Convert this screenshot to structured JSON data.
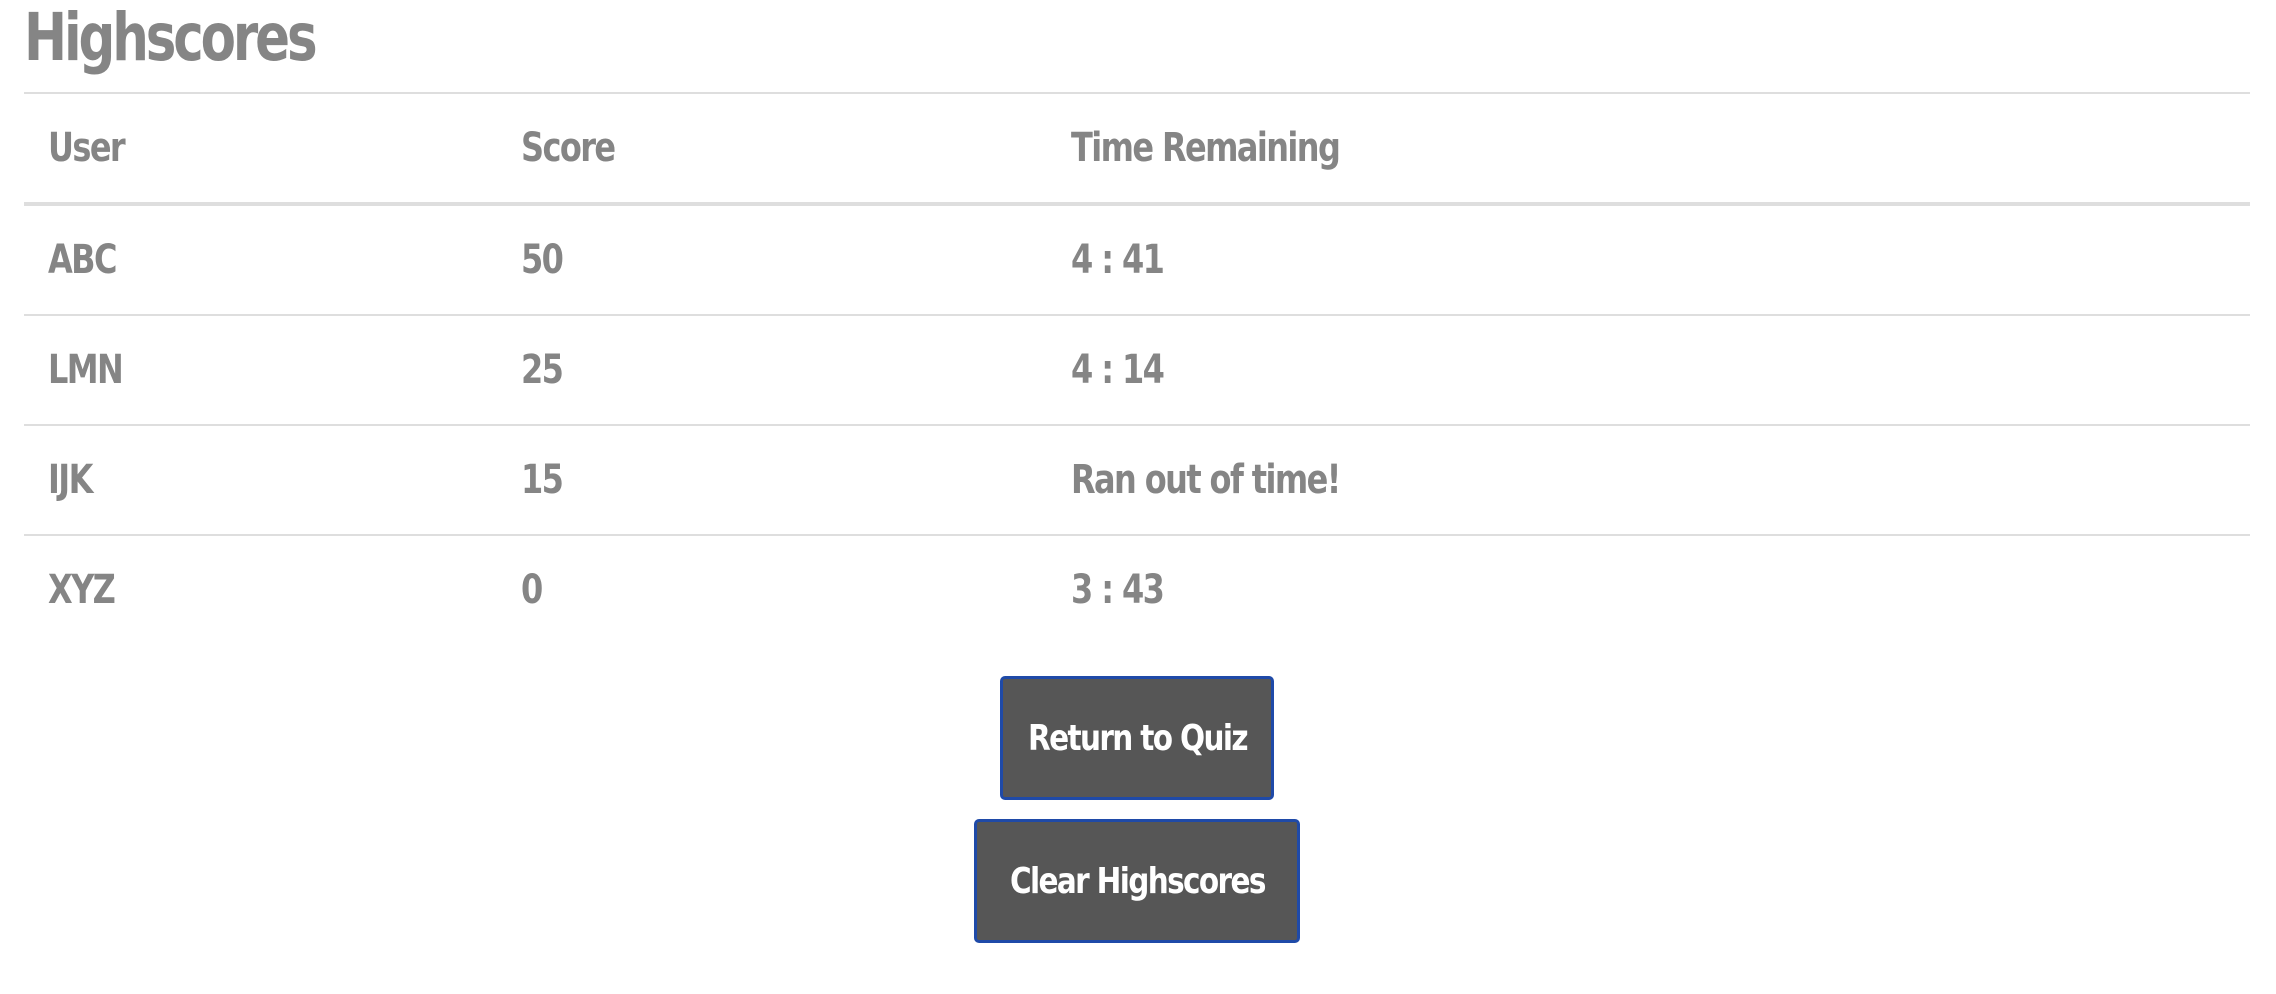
{
  "page": {
    "title": "Highscores"
  },
  "table": {
    "headers": {
      "user": "User",
      "score": "Score",
      "time": "Time Remaining"
    },
    "rows": [
      {
        "user": "ABC",
        "score": "50",
        "time": "4 : 41"
      },
      {
        "user": "LMN",
        "score": "25",
        "time": "4 : 14"
      },
      {
        "user": "IJK",
        "score": "15",
        "time": "Ran out of time!"
      },
      {
        "user": "XYZ",
        "score": "0",
        "time": "3 : 43"
      }
    ]
  },
  "actions": {
    "return_label": "Return to Quiz",
    "clear_label": "Clear Highscores"
  },
  "colors": {
    "text": "#858585",
    "button_bg": "#565656",
    "button_border": "#1f4aa8",
    "button_text": "#ffffff",
    "divider": "#dedede"
  }
}
